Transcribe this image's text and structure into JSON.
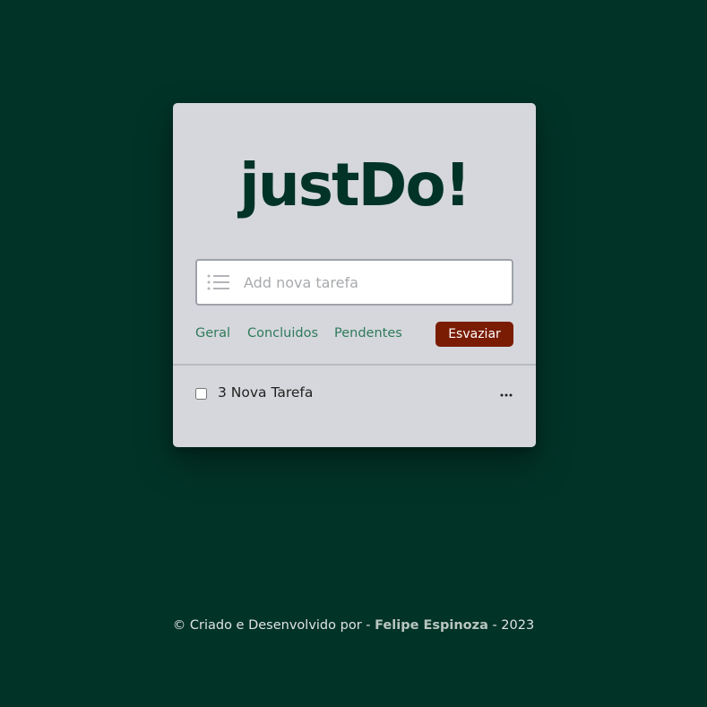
{
  "app": {
    "logo_text": "justDo!"
  },
  "input": {
    "placeholder": "Add nova tarefa",
    "value": "",
    "icon": "list-icon"
  },
  "filters": {
    "items": [
      {
        "label": "Geral"
      },
      {
        "label": "Concluidos"
      },
      {
        "label": "Pendentes"
      }
    ],
    "clear_label": "Esvaziar"
  },
  "tasks": [
    {
      "label": "3 Nova Tarefa",
      "checked": false,
      "menu_icon": "more-horizontal-icon"
    }
  ],
  "footer": {
    "prefix": "© Criado e Desenvolvido por - ",
    "author": "Felipe Espinoza",
    "suffix": " - 2023"
  },
  "colors": {
    "background": "#023327",
    "card": "#d5d7dc",
    "accent": "#2e7a5a",
    "danger_button": "#7a1c04"
  }
}
